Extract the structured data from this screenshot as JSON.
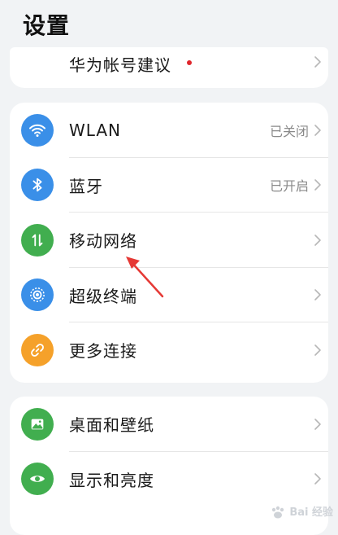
{
  "header": {
    "title": "设置"
  },
  "account": {
    "label": "华为帐号建议",
    "dot_color": "#e0262c"
  },
  "group1": [
    {
      "label": "WLAN",
      "status": "已关闭",
      "icon": "wifi-icon",
      "color": "#3a8fe8"
    },
    {
      "label": "蓝牙",
      "status": "已开启",
      "icon": "bluetooth-icon",
      "color": "#3a8fe8"
    },
    {
      "label": "移动网络",
      "status": "",
      "icon": "mobile-network-icon",
      "color": "#41ae4f"
    },
    {
      "label": "超级终端",
      "status": "",
      "icon": "super-device-icon",
      "color": "#3a8fe8"
    },
    {
      "label": "更多连接",
      "status": "",
      "icon": "link-icon",
      "color": "#f5a12a"
    }
  ],
  "group2": [
    {
      "label": "桌面和壁纸",
      "icon": "wallpaper-icon",
      "color": "#41ae4f"
    },
    {
      "label": "显示和亮度",
      "icon": "display-eye-icon",
      "color": "#41ae4f"
    }
  ],
  "watermark": {
    "text": "Bai 经验",
    "icon": "baidu-paw-icon"
  }
}
